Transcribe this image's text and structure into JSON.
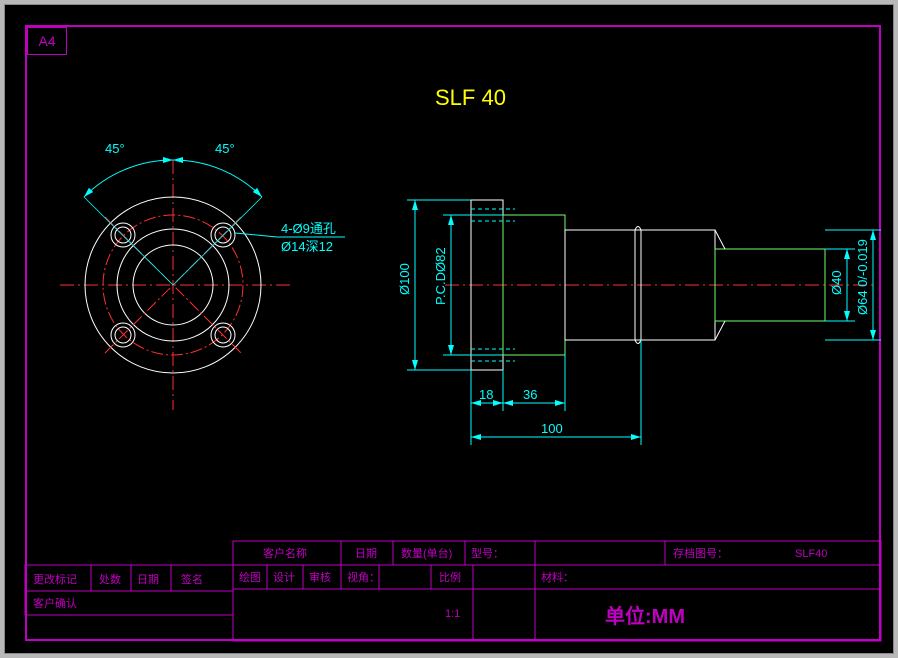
{
  "sheet": "A4",
  "title": "SLF 40",
  "angles": {
    "left": "45°",
    "right": "45°"
  },
  "holes": {
    "count_dia": "4-Ø9通孔",
    "cbore": "Ø14深12"
  },
  "dims": {
    "d100": "Ø100",
    "pcd": "P.C.DØ82",
    "d40": "Ø40",
    "d64tol": "Ø64 0/-0.019",
    "l18": "18",
    "l36": "36",
    "l100": "100"
  },
  "titleblock": {
    "customer": "客户名称",
    "date": "日期",
    "qty": "数量(单台)",
    "model": "型号：",
    "archive": "存档图号：",
    "archive_val": "SLF40",
    "drawn": "绘图",
    "design": "设计",
    "check": "审核",
    "view": "视角：",
    "scale": "比例",
    "scale_val": "1:1",
    "material": "材料：",
    "unit": "单位:MM",
    "revmark": "更改标记",
    "where": "处数",
    "date2": "日期",
    "sign": "签名",
    "confirm": "客户确认"
  }
}
